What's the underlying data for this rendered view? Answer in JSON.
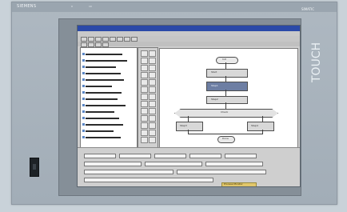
{
  "device": {
    "brand": "SIEMENS",
    "tiny_labels": [
      "0",
      "10"
    ],
    "model": "SIMATIC",
    "touch_label": "TOUCH"
  },
  "screen": {
    "diagram": {
      "labels": [
        "Init",
        "Start",
        "Step1",
        "Step2",
        "Check",
        "Trans",
        "Step3",
        "Step4",
        "Done"
      ]
    },
    "status": {
      "text": "Process Monitor"
    }
  }
}
